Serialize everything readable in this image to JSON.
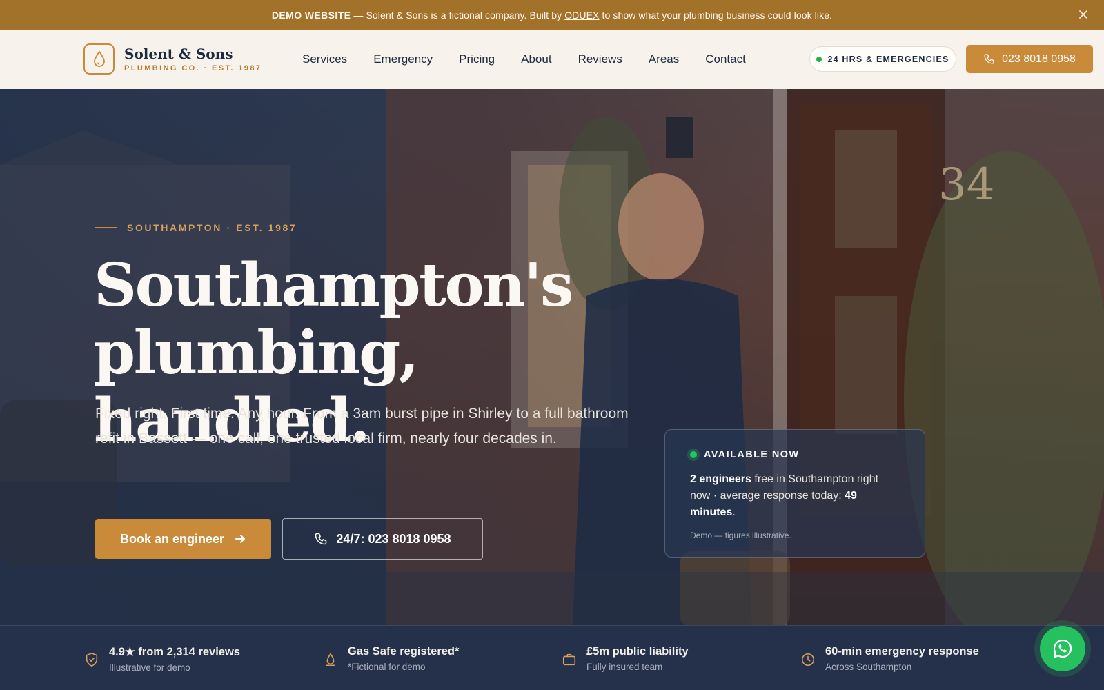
{
  "banner": {
    "strong": "DEMO WEBSITE",
    "text_before": " — Solent & Sons is a fictional company. Built by ",
    "link": "ODUEX",
    "text_after": " to show what your plumbing business could look like."
  },
  "header": {
    "logo_name": "Solent & Sons",
    "logo_sub": "PLUMBING CO. · EST. 1987",
    "nav": [
      "Services",
      "Emergency",
      "Pricing",
      "About",
      "Reviews",
      "Areas",
      "Contact"
    ],
    "pill_label": "24 HRS & EMERGENCIES",
    "call_label": "023 8018 0958"
  },
  "hero": {
    "eyebrow": "SOUTHAMPTON · EST. 1987",
    "headline_line1": "Southampton's",
    "headline_line2": "plumbing, handled.",
    "subtext": "Fixed right. First time. Any hour. From a 3am burst pipe in Shirley to a full bathroom refit in Bassett — one call, one trusted local firm, nearly four decades in.",
    "primary_button": "Book an engineer",
    "secondary_button": "24/7: 023 8018 0958",
    "house_number": "34"
  },
  "availability": {
    "heading": "AVAILABLE NOW",
    "engineers": "2 engineers",
    "text_mid": " free in Southampton right now · average response today: ",
    "minutes": "49 minutes",
    "text_end": ".",
    "note": "Demo — figures illustrative."
  },
  "trust": [
    {
      "title": "4.9★ from 2,314 reviews",
      "sub": "Illustrative for demo",
      "icon": "shield-check-icon"
    },
    {
      "title": "Gas Safe registered*",
      "sub": "*Fictional for demo",
      "icon": "flame-icon"
    },
    {
      "title": "£5m public liability",
      "sub": "Fully insured team",
      "icon": "briefcase-icon"
    },
    {
      "title": "60-min emergency response",
      "sub": "Across Southampton",
      "icon": "clock-icon"
    }
  ],
  "colors": {
    "accent": "#c98a3a",
    "banner_bg": "#a3722a",
    "navy": "#1d2a3f",
    "status_green": "#22c55e"
  }
}
